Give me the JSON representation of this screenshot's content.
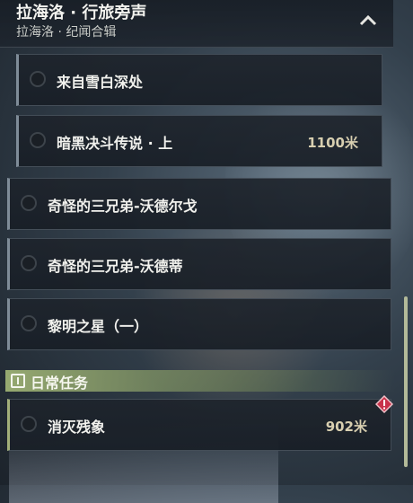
{
  "header": {
    "title": "拉海洛 · 行旅旁声",
    "subtitle": "拉海洛 · 纪闻合辑"
  },
  "quests": [
    {
      "label": "来自雪白深处",
      "distance": ""
    },
    {
      "label": "暗黑决斗传说 · 上",
      "distance": "1100米"
    },
    {
      "label": "奇怪的三兄弟-沃德尔戈",
      "distance": ""
    },
    {
      "label": "奇怪的三兄弟-沃德蒂",
      "distance": ""
    },
    {
      "label": "黎明之星（一）",
      "distance": ""
    }
  ],
  "daily": {
    "section_label": "日常任务",
    "quests": [
      {
        "label": "消灭残象",
        "distance": "902米"
      }
    ]
  },
  "colors": {
    "section_green": "#9cb074",
    "alert_red": "#c8324a",
    "distance_text": "#d8cfb0"
  },
  "icons": {
    "collapse": "chevron-up-icon",
    "section": "info-box-icon",
    "alert": "diamond-alert-icon"
  }
}
